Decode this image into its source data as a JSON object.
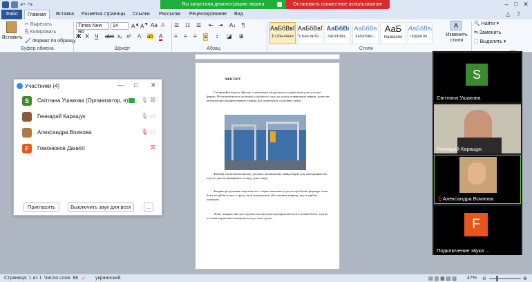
{
  "word": {
    "title_bar": {
      "share_banner": "Вы запустили демонстрацию экрана",
      "stop_share": "Остановить совместное использование"
    },
    "tabs": [
      "Файл",
      "Главная",
      "Вставка",
      "Разметка страницы",
      "Ссылки",
      "Рассылки",
      "Рецензирование",
      "Вид"
    ],
    "ribbon": {
      "clipboard": {
        "paste": "Вставить",
        "cut": "Вырезать",
        "copy": "Копировать",
        "format_painter": "Формат по образцу",
        "group_label": "Буфер обмена"
      },
      "font": {
        "font_name": "Times New Ro",
        "font_size": "14",
        "group_label": "Шрифт"
      },
      "paragraph": {
        "group_label": "Абзац"
      },
      "styles": {
        "items": [
          {
            "sample": "АаБбВвГг,",
            "name": "¶ Обычный"
          },
          {
            "sample": "АаБбВвГг,",
            "name": "¶ Без инте..."
          },
          {
            "sample": "АаБбВі",
            "name": "Заголово..."
          },
          {
            "sample": "АаБбВв",
            "name": "Заголово..."
          },
          {
            "sample": "АаБ",
            "name": "Название"
          },
          {
            "sample": "АаБбВеІ",
            "name": "Подзагол..."
          }
        ],
        "change_styles": "Изменить стили",
        "group_label": "Стили"
      },
      "editing": {
        "find": "Найти",
        "replace": "Заменить",
        "select": "Выделить"
      }
    },
    "document": {
      "heading": "АФІСОРТ",
      "paragraphs": [
        "Сепараційні ворота Афісорт є важливим інструментом управління для сучасної ферми. Встановлюються на виході з доїльного залу по шляху повернення тварин, дозволяє автоматично відокремлювати тварин, які потребують особливої уваги.",
        "Фермер, натискаючи кнопку доїльня, автоматично знайде корів для запліднення або, під час дня ветеринарного огляду, для огляду.",
        "Завдяки розділенню воротами все тварин можливо усунути проблеми фермера, коли йому потрібно узяти в групу, щоб відокремити або спиняти тварину, яку потрібно оглянути.",
        "Лише тварина, яка має шукати, автоматично відокремлюється в певній боксі, тоді як усі інші нормально повертаються до своєї групи."
      ]
    },
    "status_bar": {
      "page": "Страница: 1 из 1",
      "words": "Число слов: 88",
      "language": "украинский",
      "zoom": "47%"
    }
  },
  "participants": {
    "title": "Участники (4)",
    "list": [
      {
        "initial": "S",
        "name": "Світлана Ушакова (Организатор, я)",
        "color": "#3b8a2e"
      },
      {
        "initial": "",
        "name": "Геннадий Каращук",
        "color": "#8a5a3a"
      },
      {
        "initial": "",
        "name": "Александра Воинова",
        "color": "#b07a45"
      },
      {
        "initial": "F",
        "name": "Гомонюков Даниїл",
        "color": "#e8561e"
      }
    ],
    "invite": "Пригласить",
    "mute_all": "Выключить звук для всех",
    "more": "..."
  },
  "video": {
    "tiles": [
      {
        "name": "Світлана Ушакова",
        "initial": "S",
        "color": "#3b8a2e"
      },
      {
        "name": "Геннадий Каращук"
      },
      {
        "name": "Александра Воинова"
      },
      {
        "name": "Подключение звука ...",
        "initial": "F",
        "color": "#e8561e"
      }
    ]
  }
}
